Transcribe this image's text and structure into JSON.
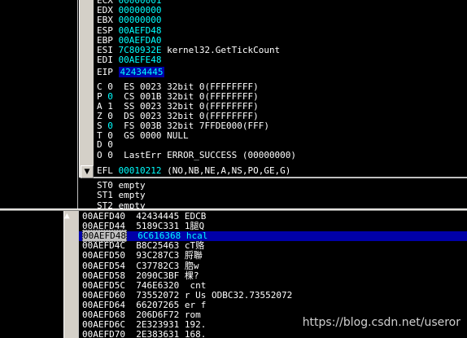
{
  "registers": [
    {
      "name": "ECX",
      "value": "00000001",
      "comment": ""
    },
    {
      "name": "EDX",
      "value": "00000000",
      "comment": ""
    },
    {
      "name": "EBX",
      "value": "00000000",
      "comment": ""
    },
    {
      "name": "ESP",
      "value": "00AEFD48",
      "comment": ""
    },
    {
      "name": "EBP",
      "value": "00AEFDA0",
      "comment": ""
    },
    {
      "name": "ESI",
      "value": "7C80932E",
      "comment": "kernel32.GetTickCount"
    },
    {
      "name": "EDI",
      "value": "00AEFE48",
      "comment": ""
    }
  ],
  "eip": {
    "name": "EIP",
    "value": "42434445"
  },
  "flags": [
    {
      "flag": "C",
      "bit": "0",
      "seg": "ES",
      "sel": "0023",
      "mode": "32bit",
      "range": "0(FFFFFFFF)"
    },
    {
      "flag": "P",
      "bit": "0",
      "seg": "CS",
      "sel": "001B",
      "mode": "32bit",
      "range": "0(FFFFFFFF)"
    },
    {
      "flag": "A",
      "bit": "1",
      "seg": "SS",
      "sel": "0023",
      "mode": "32bit",
      "range": "0(FFFFFFFF)"
    },
    {
      "flag": "Z",
      "bit": "0",
      "seg": "DS",
      "sel": "0023",
      "mode": "32bit",
      "range": "0(FFFFFFFF)"
    },
    {
      "flag": "S",
      "bit": "0",
      "seg": "FS",
      "sel": "003B",
      "mode": "32bit",
      "range": "7FFDE000(FFF)"
    },
    {
      "flag": "T",
      "bit": "0",
      "seg": "GS",
      "sel": "0000",
      "mode": "NULL",
      "range": ""
    }
  ],
  "flag_d": "D 0",
  "flag_o": "O 0",
  "lasterr": {
    "label": "LastErr",
    "value": "ERROR_SUCCESS (00000000)"
  },
  "efl": {
    "label": "EFL",
    "value": "00010212",
    "desc": "(NO,NB,NE,A,NS,PO,GE,G)"
  },
  "fpu": [
    {
      "name": "ST0",
      "value": "empty"
    },
    {
      "name": "ST1",
      "value": "empty"
    },
    {
      "name": "ST2",
      "value": "empty"
    }
  ],
  "dump": [
    {
      "addr": "00AEFD40",
      "value": "42434445",
      "text": "EDCB"
    },
    {
      "addr": "00AEFD44",
      "value": "5189C331",
      "text": "1腿Q"
    },
    {
      "addr": "00AEFD48",
      "value": "6C616368",
      "text": "hcal"
    },
    {
      "addr": "00AEFD4C",
      "value": "B8C25463",
      "text": "cT赂"
    },
    {
      "addr": "00AEFD50",
      "value": "93C287C3",
      "text": "脟聯"
    },
    {
      "addr": "00AEFD54",
      "value": "C37782C3",
      "text": "脗w"
    },
    {
      "addr": "00AEFD58",
      "value": "2090C3BF",
      "text": "棵?"
    },
    {
      "addr": "00AEFD5C",
      "value": "746E6320",
      "text": " cnt"
    },
    {
      "addr": "00AEFD60",
      "value": "73552072",
      "text": "r Us ODBC32.73552072"
    },
    {
      "addr": "00AEFD64",
      "value": "66207265",
      "text": "er f"
    },
    {
      "addr": "00AEFD68",
      "value": "206D6F72",
      "text": "rom"
    },
    {
      "addr": "00AEFD6C",
      "value": "2E323931",
      "text": "192."
    },
    {
      "addr": "00AEFD70",
      "value": "2E383631",
      "text": "168."
    }
  ],
  "watermark": "https://blog.csdn.net/useror",
  "colors": {
    "accent": "#00ffff",
    "selection": "#0000a8",
    "chrome": "#d4d0c8"
  }
}
